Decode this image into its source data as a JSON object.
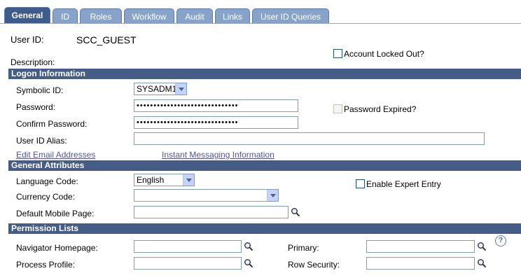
{
  "tabs": [
    {
      "label": "General",
      "active": true
    },
    {
      "label": "ID",
      "active": false
    },
    {
      "label": "Roles",
      "active": false
    },
    {
      "label": "Workflow",
      "active": false
    },
    {
      "label": "Audit",
      "active": false
    },
    {
      "label": "Links",
      "active": false
    },
    {
      "label": "User ID Queries",
      "active": false
    }
  ],
  "header": {
    "user_id_label": "User ID:",
    "user_id_value": "SCC_GUEST",
    "description_label": "Description:",
    "account_locked_label": "Account Locked Out?"
  },
  "logon": {
    "section_title": "Logon Information",
    "symbolic_id_label": "Symbolic ID:",
    "symbolic_id_value": "SYSADM1",
    "password_label": "Password:",
    "password_value": "••••••••••••••••••••••••••••••",
    "password_expired_label": "Password Expired?",
    "confirm_password_label": "Confirm Password:",
    "confirm_password_value": "••••••••••••••••••••••••••••••",
    "user_id_alias_label": "User ID Alias:",
    "user_id_alias_value": "",
    "edit_email_link": "Edit Email Addresses",
    "instant_messaging_link": "Instant Messaging Information"
  },
  "general_attributes": {
    "section_title": "General Attributes",
    "language_code_label": "Language Code:",
    "language_code_value": "English",
    "enable_expert_entry_label": "Enable Expert Entry",
    "currency_code_label": "Currency Code:",
    "currency_code_value": "",
    "default_mobile_page_label": "Default Mobile Page:",
    "default_mobile_page_value": ""
  },
  "permission_lists": {
    "section_title": "Permission Lists",
    "navigator_homepage_label": "Navigator Homepage:",
    "process_profile_label": "Process Profile:",
    "primary_label": "Primary:",
    "row_security_label": "Row Security:",
    "help_symbol": "?"
  },
  "colors": {
    "section_header": "#455C86",
    "tab_inactive": "#87A3C9",
    "tab_active": "#3D5B8C",
    "link": "#5252AB"
  },
  "icons": {
    "lookup": "magnifier-icon",
    "help": "help-icon",
    "dropdown": "chevron-down-icon"
  }
}
